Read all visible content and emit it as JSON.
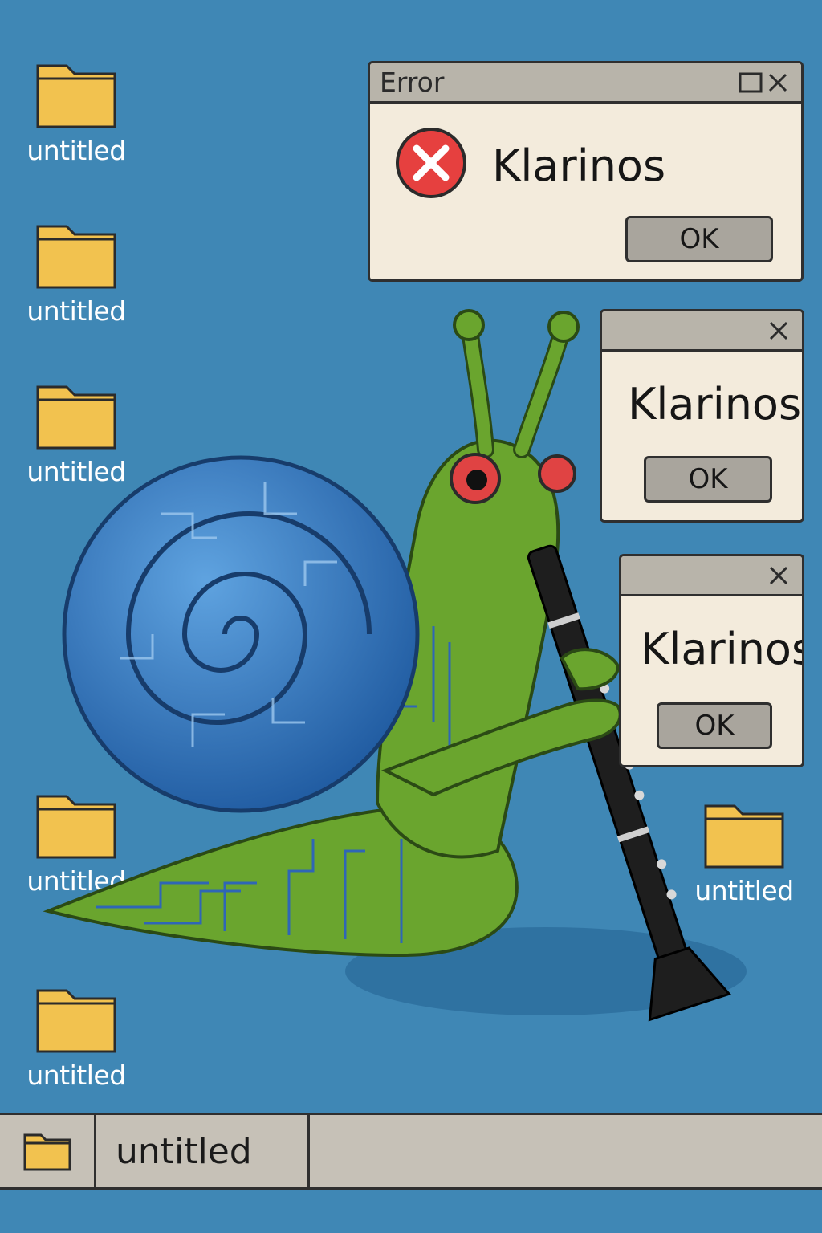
{
  "desktop": {
    "background_color": "#3f87b5",
    "icons": [
      {
        "label": "untitled",
        "icon": "folder-icon"
      },
      {
        "label": "untitled",
        "icon": "folder-icon"
      },
      {
        "label": "untitled",
        "icon": "folder-icon"
      },
      {
        "label": "untitled",
        "icon": "folder-icon"
      },
      {
        "label": "untitled",
        "icon": "folder-icon"
      },
      {
        "label": "untitled",
        "icon": "folder-icon"
      }
    ]
  },
  "dialogs": [
    {
      "title": "Error",
      "icon": "error-icon",
      "message": "Klarinos",
      "ok_label": "OK",
      "has_maximize": true
    },
    {
      "title": "",
      "message": "Klarinos",
      "ok_label": "OK",
      "has_maximize": false
    },
    {
      "title": "",
      "message": "Klarinos",
      "ok_label": "OK",
      "has_maximize": false
    }
  ],
  "taskbar": {
    "start_icon": "folder-icon",
    "task_label": "untitled"
  },
  "illustration": {
    "subject": "snail-playing-clarinet",
    "colors": {
      "shell": "#2d6db3",
      "body": "#6aa52e",
      "eye": "#e04343",
      "clarinet": "#1e1e1e",
      "folder": "#f2c24f"
    }
  }
}
